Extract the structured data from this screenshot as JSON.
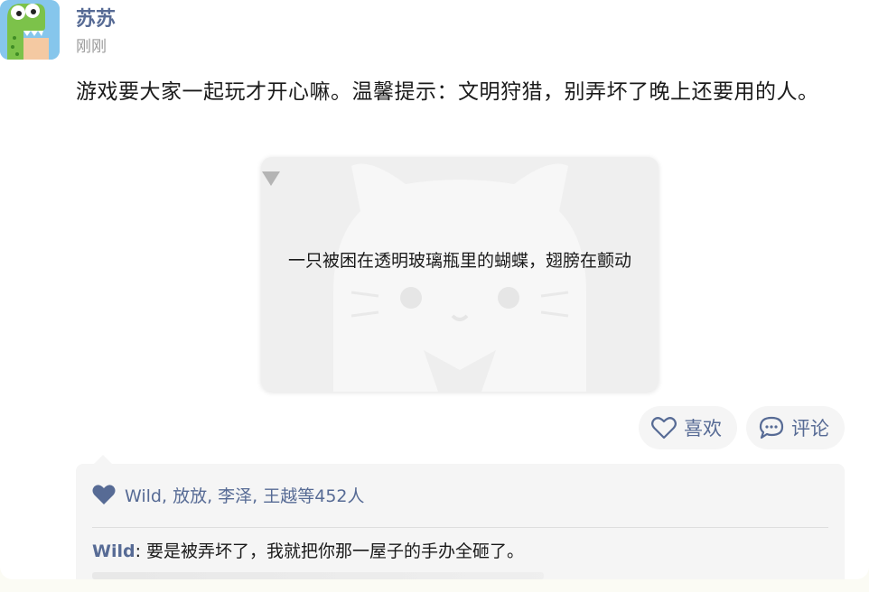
{
  "post": {
    "username": "苏苏",
    "timestamp": "刚刚",
    "text": "游戏要大家一起玩才开心嘛。温馨提示：文明狩猎，别弄坏了晚上还要用的人。",
    "media_caption": "一只被困在透明玻璃瓶里的蝴蝶，翅膀在颤动"
  },
  "actions": {
    "like_label": "喜欢",
    "comment_label": "评论"
  },
  "likes": {
    "text": "Wild, 放放, 李泽, 王越等452人"
  },
  "comments": [
    {
      "author": "Wild",
      "separator": ": ",
      "text": "要是被弄坏了，我就把你那一屋子的手办全砸了。"
    }
  ],
  "icons": {
    "avatar": "cartoon-crocodile-avatar",
    "like": "heart-outline-icon",
    "comment": "speech-bubble-icon",
    "likes_heart": "heart-filled-icon",
    "image_placeholder": "cat-placeholder-icon"
  },
  "colors": {
    "link": "#576b95",
    "text": "#1a1a1a",
    "muted": "#9a9a9a",
    "panel": "#f5f5f5"
  }
}
